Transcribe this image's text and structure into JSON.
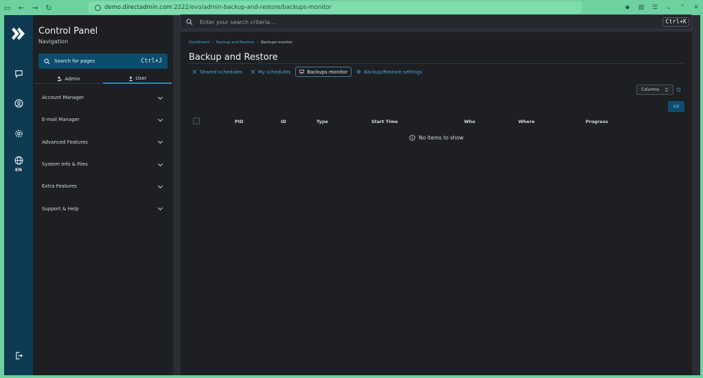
{
  "browser": {
    "url_host": "demo.directadmin.com",
    "url_path": ":2222/evo/admin-backup-and-restore/backups-monitor"
  },
  "rail": {
    "language": "EN",
    "icons": [
      "directadmin-logo-icon",
      "chat-icon",
      "user-circle-icon",
      "gear-icon",
      "globe-icon",
      "logout-icon"
    ]
  },
  "navpanel": {
    "title": "Control Panel",
    "subtitle": "Navigation",
    "search_label": "Search for pages",
    "search_shortcut": "Ctrl+J",
    "tabs": [
      {
        "label": "Admin",
        "active": false
      },
      {
        "label": "User",
        "active": true
      }
    ],
    "items": [
      {
        "label": "Account Manager"
      },
      {
        "label": "E-mail Manager"
      },
      {
        "label": "Advanced Features"
      },
      {
        "label": "System Info & Files"
      },
      {
        "label": "Extra Features"
      },
      {
        "label": "Support & Help"
      }
    ]
  },
  "topsearch": {
    "placeholder": "Enter your search criteria...",
    "shortcut": "Ctrl+K"
  },
  "main": {
    "breadcrumb": [
      "Dashboard",
      "Backup and Restore",
      "Backups monitor"
    ],
    "title": "Backup and Restore",
    "tabs": [
      {
        "label": "Shared schedules",
        "icon": "scissors-icon",
        "active": false
      },
      {
        "label": "My schedules",
        "icon": "scissors-icon",
        "active": false
      },
      {
        "label": "Backups monitor",
        "icon": "monitor-icon",
        "active": true
      },
      {
        "label": "Backup/Restore settings",
        "icon": "gear-icon",
        "active": false
      }
    ],
    "columns_label": "Columns",
    "kill_label": "Kill",
    "table": {
      "headers": [
        "PID",
        "ID",
        "Type",
        "Start Time",
        "Who",
        "Where",
        "Progress"
      ],
      "empty_text": "No items to show"
    }
  },
  "colors": {
    "browser_accent": "#6fd1a0",
    "rail_bg": "#0e3a52",
    "primary_button": "#0b4d6f",
    "link": "#4ea3d6"
  }
}
